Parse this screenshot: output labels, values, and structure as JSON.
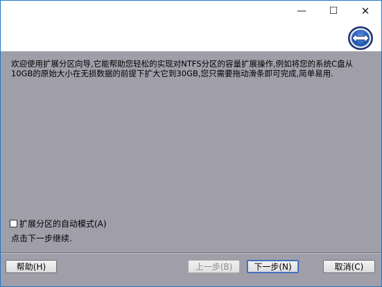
{
  "window": {
    "minimize_glyph": "—",
    "maximize_glyph": "☐",
    "close_glyph": "✕"
  },
  "header": {
    "logo_icon": "double-arrow-icon",
    "logo_colors": {
      "ring": "#1f3d8a",
      "fill": "#2f6fd0",
      "arrow": "#ffffff"
    }
  },
  "content": {
    "intro_text": "欢迎使用扩展分区向导,它能帮助您轻松的实现对NTFS分区的容量扩展操作,例如将您的系统C盘从10GB的原始大小在无损数据的前提下扩大它到30GB,您只需要拖动滑条即可完成,简单易用.",
    "auto_mode_label": "扩展分区的自动模式(A)",
    "auto_mode_checked": false,
    "continue_text": "点击下一步继续."
  },
  "footer": {
    "help_label": "帮助(H)",
    "back_label": "上一步(B)",
    "next_label": "下一步(N)",
    "cancel_label": "取消(C)"
  },
  "colors": {
    "content_bg": "#a09ea9",
    "window_border": "#1979ca"
  }
}
